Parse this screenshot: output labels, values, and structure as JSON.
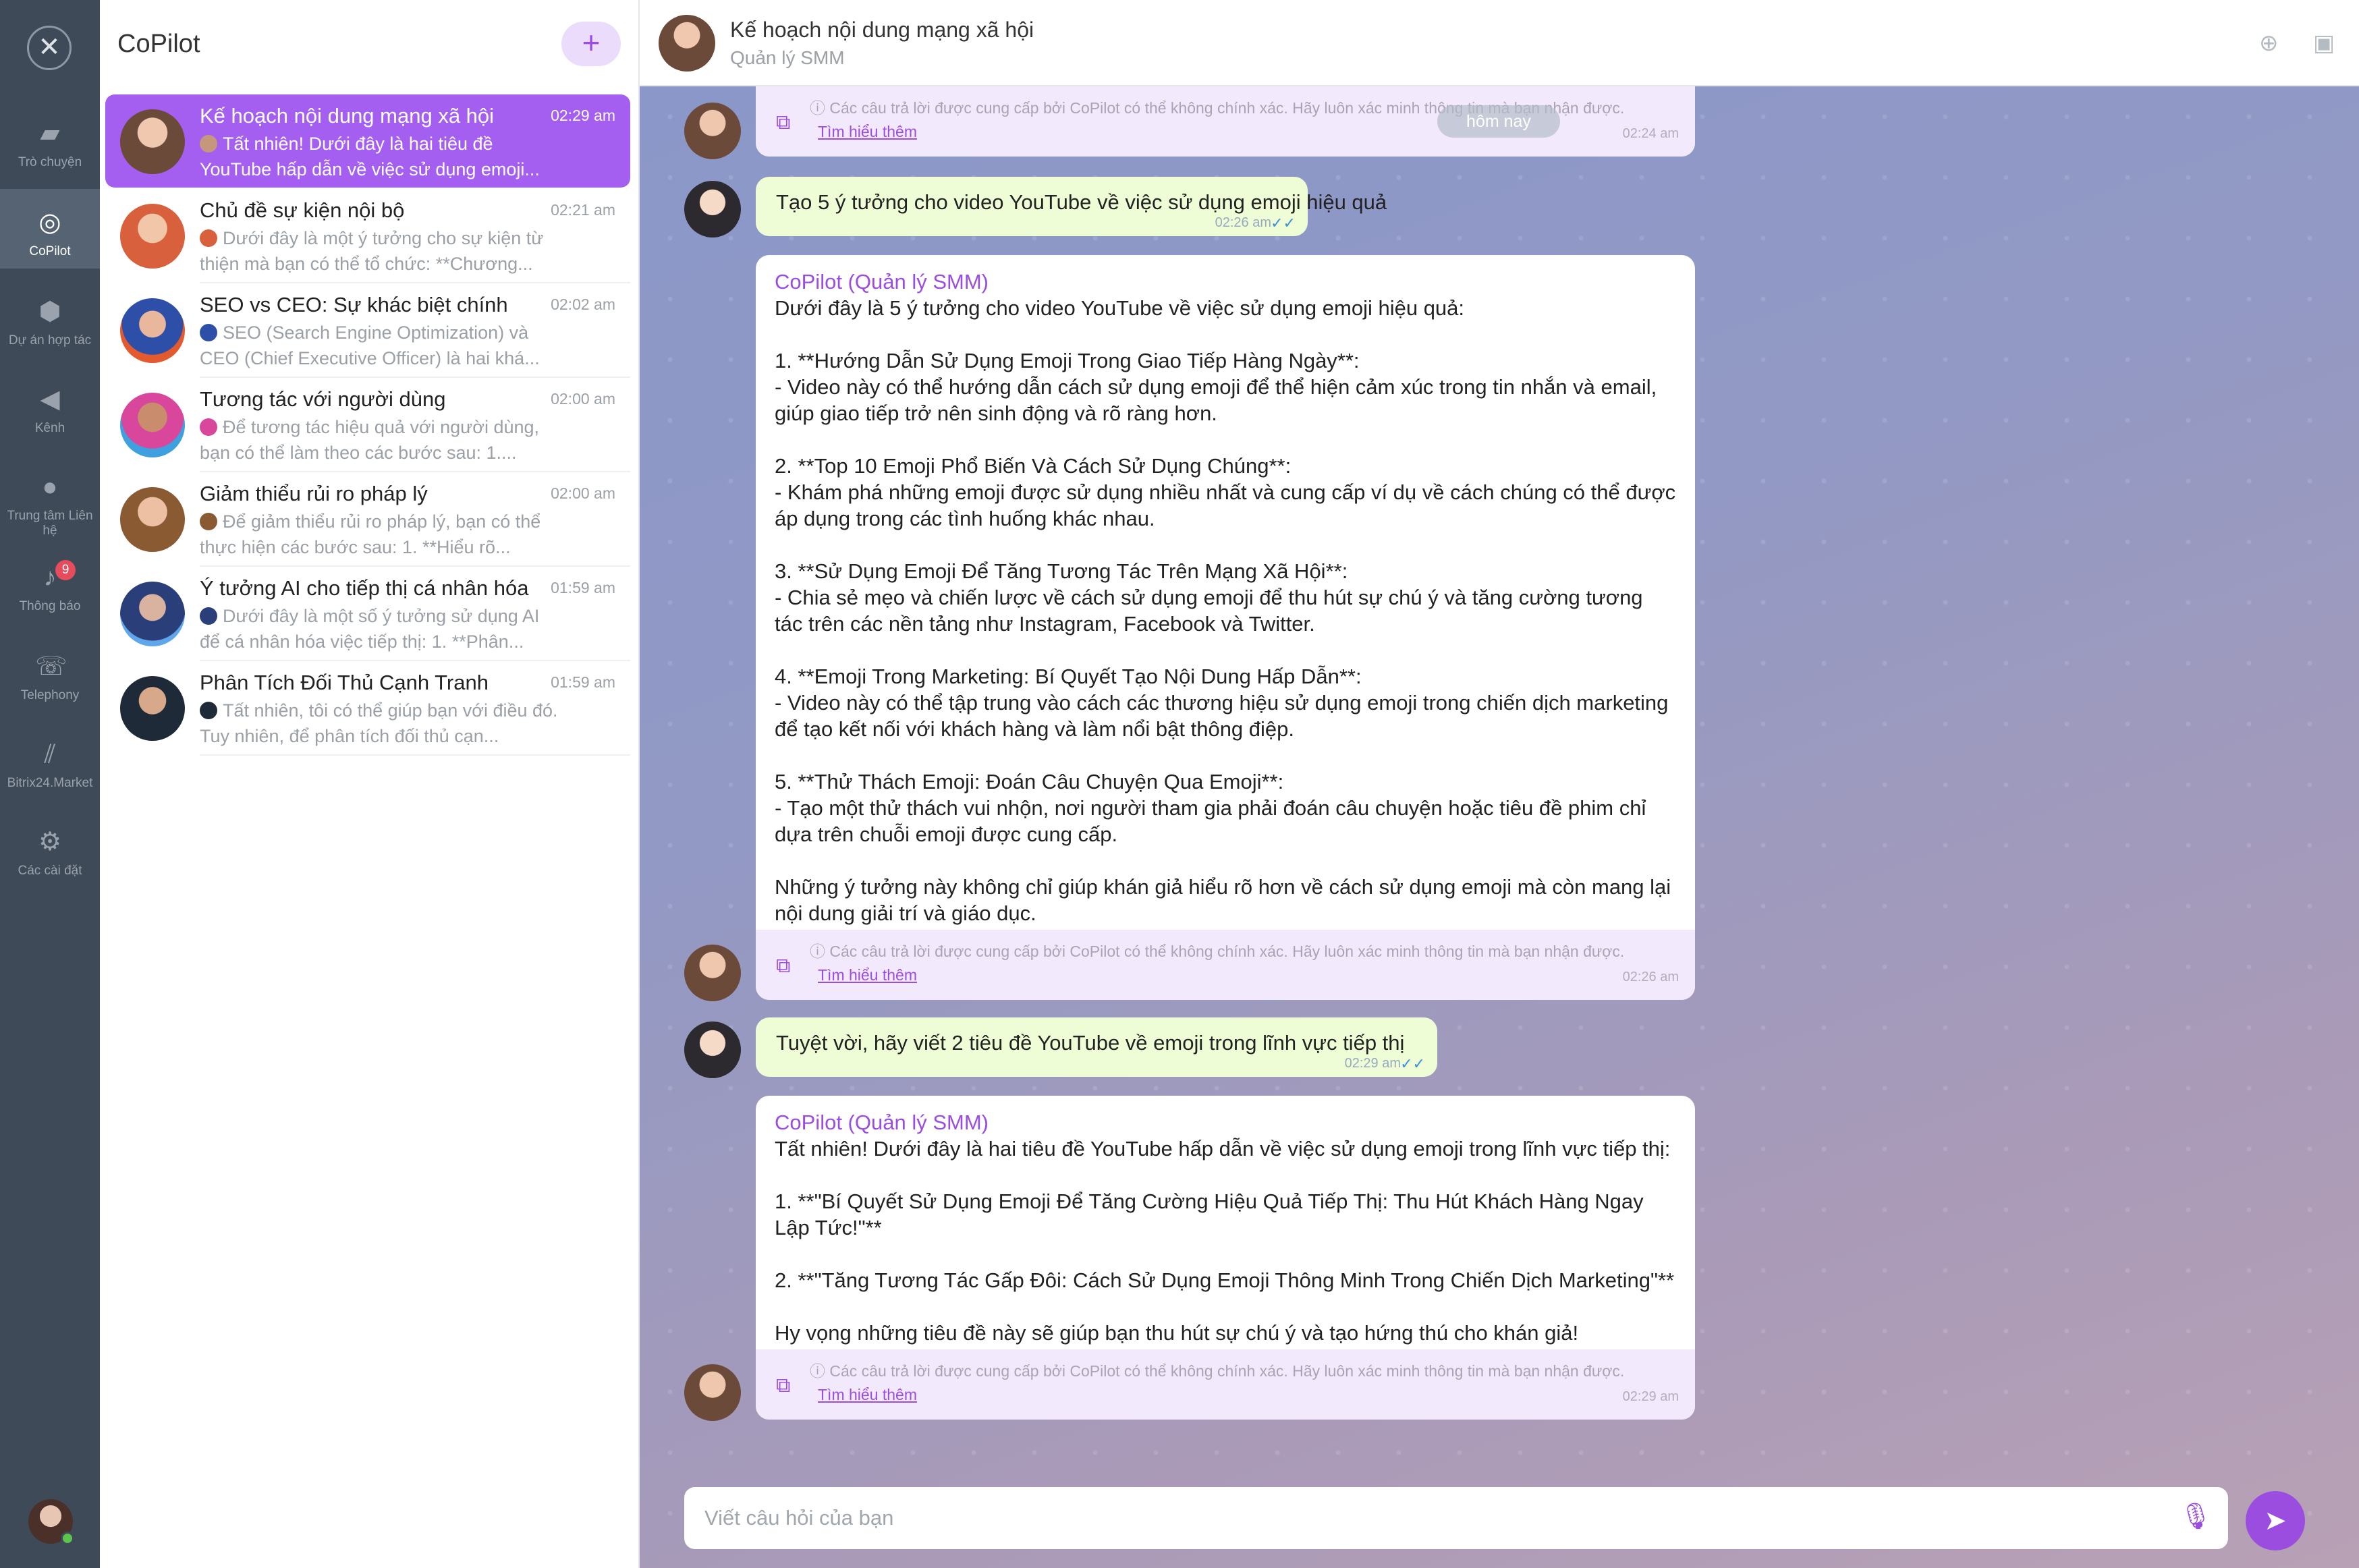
{
  "rail": {
    "items": [
      {
        "icon": "chat-bubbles-icon",
        "label": "Trò chuyện"
      },
      {
        "icon": "copilot-icon",
        "label": "CoPilot"
      },
      {
        "icon": "meeting-icon",
        "label": "Dự án hợp tác"
      },
      {
        "icon": "megaphone-icon",
        "label": "Kênh"
      },
      {
        "icon": "contact-center-icon",
        "label": "Trung tâm Liên hệ"
      },
      {
        "icon": "bell-icon",
        "label": "Thông báo",
        "badge": "9"
      },
      {
        "icon": "phone-icon",
        "label": "Telephony"
      },
      {
        "icon": "market-icon",
        "label": "Bitrix24.Market"
      },
      {
        "icon": "gear-icon",
        "label": "Các cài đặt"
      }
    ]
  },
  "sidebar": {
    "title": "CoPilot",
    "new_button": "+",
    "chats": [
      {
        "name": "Kế hoạch nội dung mạng xã hội",
        "time": "02:29 am",
        "preview": "Tất nhiên! Dưới đây là hai tiêu đề YouTube hấp dẫn về việc sử dụng emoji..."
      },
      {
        "name": "Chủ đề sự kiện nội bộ",
        "time": "02:21 am",
        "preview": "Dưới đây là một ý tưởng cho sự kiện từ thiện mà bạn có thể tổ chức: **Chương..."
      },
      {
        "name": "SEO vs CEO: Sự khác biệt chính",
        "time": "02:02 am",
        "preview": "SEO (Search Engine Optimization) và CEO (Chief Executive Officer) là hai khá..."
      },
      {
        "name": "Tương tác với người dùng",
        "time": "02:00 am",
        "preview": "Để tương tác hiệu quả với người dùng, bạn có thể làm theo các bước sau: 1...."
      },
      {
        "name": "Giảm thiểu rủi ro pháp lý",
        "time": "02:00 am",
        "preview": "Để giảm thiểu rủi ro pháp lý, bạn có thể thực hiện các bước sau: 1. **Hiểu rõ..."
      },
      {
        "name": "Ý tưởng AI cho tiếp thị cá nhân hóa",
        "time": "01:59 am",
        "preview": "Dưới đây là một số ý tưởng sử dụng AI để cá nhân hóa việc tiếp thị: 1. **Phân..."
      },
      {
        "name": "Phân Tích Đối Thủ Cạnh Tranh",
        "time": "01:59 am",
        "preview": "Tất nhiên, tôi có thể giúp bạn với điều đó. Tuy nhiên, để phân tích đối thủ cạn..."
      }
    ]
  },
  "header": {
    "title": "Kế hoạch nội dung mạng xã hội",
    "subtitle": "Quản lý SMM"
  },
  "day_pill": "hôm nay",
  "disclaimer": {
    "text": "ⓘ Các câu trả lời được cung cấp bởi CoPilot có thể không chính xác. Hãy luôn xác minh thông tin mà bạn nhận được.",
    "link": "Tìm hiểu thêm"
  },
  "messages": [
    {
      "type": "disclaimer-only",
      "time": "02:24 am"
    },
    {
      "type": "user",
      "text": "Tạo 5 ý tưởng cho video YouTube về việc sử dụng emoji hiệu quả",
      "time": "02:26 am"
    },
    {
      "type": "bot",
      "sender": "CoPilot (Quản lý SMM)",
      "time": "02:26 am",
      "text": "Dưới đây là 5 ý tưởng cho video YouTube về việc sử dụng emoji hiệu quả:\n\n1. **Hướng Dẫn Sử Dụng Emoji Trong Giao Tiếp Hàng Ngày**:\n- Video này có thể hướng dẫn cách sử dụng emoji để thể hiện cảm xúc trong tin nhắn và email, giúp giao tiếp trở nên sinh động và rõ ràng hơn.\n\n2. **Top 10 Emoji Phổ Biến Và Cách Sử Dụng Chúng**:\n- Khám phá những emoji được sử dụng nhiều nhất và cung cấp ví dụ về cách chúng có thể được áp dụng trong các tình huống khác nhau.\n\n3. **Sử Dụng Emoji Để Tăng Tương Tác Trên Mạng Xã Hội**:\n- Chia sẻ mẹo và chiến lược về cách sử dụng emoji để thu hút sự chú ý và tăng cường tương tác trên các nền tảng như Instagram, Facebook và Twitter.\n\n4. **Emoji Trong Marketing: Bí Quyết Tạo Nội Dung Hấp Dẫn**:\n- Video này có thể tập trung vào cách các thương hiệu sử dụng emoji trong chiến dịch marketing để tạo kết nối với khách hàng và làm nổi bật thông điệp.\n\n5. **Thử Thách Emoji: Đoán Câu Chuyện Qua Emoji**:\n- Tạo một thử thách vui nhộn, nơi người tham gia phải đoán câu chuyện hoặc tiêu đề phim chỉ dựa trên chuỗi emoji được cung cấp.\n\nNhững ý tưởng này không chỉ giúp khán giả hiểu rõ hơn về cách sử dụng emoji mà còn mang lại nội dung giải trí và giáo dục."
    },
    {
      "type": "user",
      "text": "Tuyệt vời, hãy viết 2 tiêu đề YouTube về emoji trong lĩnh vực tiếp thị",
      "time": "02:29 am"
    },
    {
      "type": "bot",
      "sender": "CoPilot (Quản lý SMM)",
      "time": "02:29 am",
      "text": "Tất nhiên! Dưới đây là hai tiêu đề YouTube hấp dẫn về việc sử dụng emoji trong lĩnh vực tiếp thị:\n\n1. **\"Bí Quyết Sử Dụng Emoji Để Tăng Cường Hiệu Quả Tiếp Thị: Thu Hút Khách Hàng Ngay Lập Tức!\"**\n\n2. **\"Tăng Tương Tác Gấp Đôi: Cách Sử Dụng Emoji Thông Minh Trong Chiến Dịch Marketing\"**\n\nHy vọng những tiêu đề này sẽ giúp bạn thu hút sự chú ý và tạo hứng thú cho khán giả!"
    }
  ],
  "composer": {
    "placeholder": "Viết câu hỏi của bạn"
  },
  "colors": {
    "accent": "#9b4de0",
    "user_bubble": "#eefdd5",
    "rail": "#3e4a57"
  }
}
